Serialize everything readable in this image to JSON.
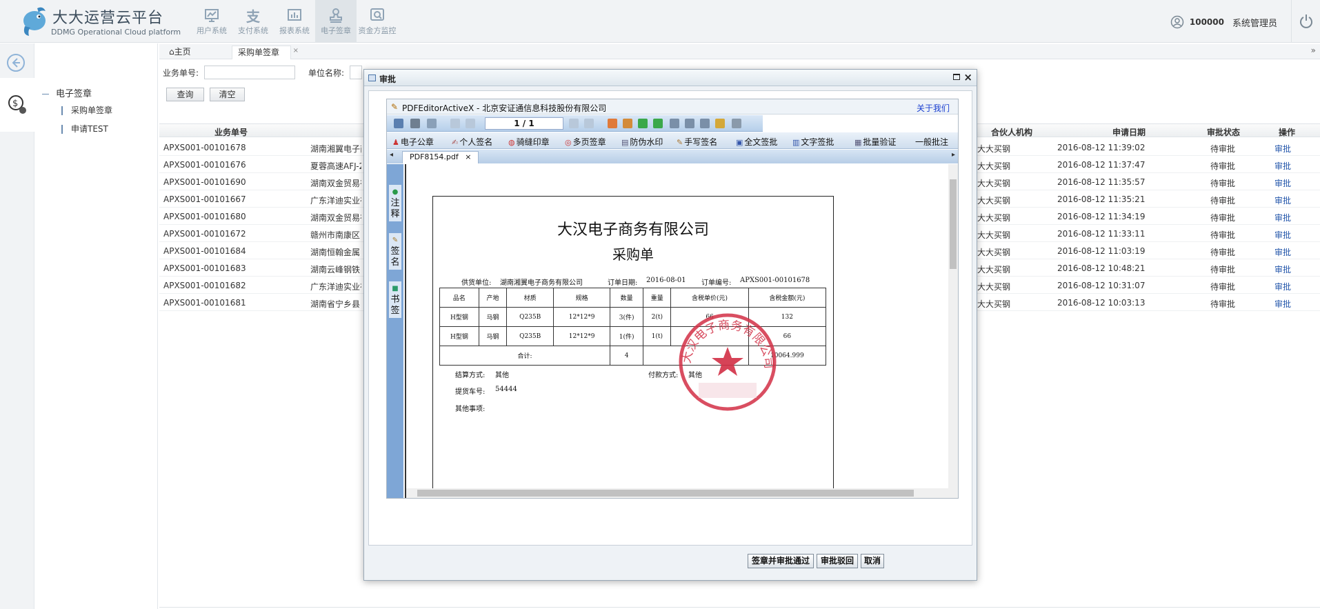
{
  "header": {
    "brand_cn": "大大运营云平台",
    "brand_en": "DDMG Operational Cloud platform",
    "nav": [
      {
        "label": "用户系统",
        "icon": "chart-board-icon"
      },
      {
        "label": "支付系统",
        "icon": "yuan-icon"
      },
      {
        "label": "报表系统",
        "icon": "report-icon"
      },
      {
        "label": "电子签章",
        "icon": "stamp-icon"
      },
      {
        "label": "资金方监控",
        "icon": "monitor-icon"
      }
    ],
    "active_nav": "电子签章",
    "user_id": "100000",
    "user_role": "系统管理员"
  },
  "menu": {
    "group": "电子签章",
    "items": [
      "采购单签章",
      "申请TEST"
    ]
  },
  "tabs": {
    "home": "主页",
    "active": "采购单签章"
  },
  "search": {
    "biz_no_label": "业务单号:",
    "unit_label": "单位名称:",
    "query_btn": "查询",
    "clear_btn": "清空"
  },
  "table": {
    "headers": {
      "biz_no": "业务单号",
      "partner": "合伙人机构",
      "date": "申请日期",
      "status": "审批状态",
      "op": "操作"
    },
    "rows": [
      {
        "biz_no": "APXS001-00101678",
        "unit": "湖南湘翼电子商",
        "partner": "大大买钢",
        "date": "2016-08-12 11:39:02",
        "status": "待审批",
        "op": "审批"
      },
      {
        "biz_no": "APXS001-00101676",
        "unit": "夏蓉高速AFJ-2",
        "partner": "大大买钢",
        "date": "2016-08-12 11:37:47",
        "status": "待审批",
        "op": "审批"
      },
      {
        "biz_no": "APXS001-00101690",
        "unit": "湖南双金贸易有",
        "partner": "大大买钢",
        "date": "2016-08-12 11:35:57",
        "status": "待审批",
        "op": "审批"
      },
      {
        "biz_no": "APXS001-00101667",
        "unit": "广东洋迪实业有",
        "partner": "大大买钢",
        "date": "2016-08-12 11:35:21",
        "status": "待审批",
        "op": "审批"
      },
      {
        "biz_no": "APXS001-00101680",
        "unit": "湖南双金贸易有",
        "partner": "大大买钢",
        "date": "2016-08-12 11:34:19",
        "status": "待审批",
        "op": "审批"
      },
      {
        "biz_no": "APXS001-00101672",
        "unit": "赣州市南康区",
        "partner": "大大买钢",
        "date": "2016-08-12 11:33:11",
        "status": "待审批",
        "op": "审批"
      },
      {
        "biz_no": "APXS001-00101684",
        "unit": "湖南恒翰金属",
        "partner": "大大买钢",
        "date": "2016-08-12 11:03:19",
        "status": "待审批",
        "op": "审批"
      },
      {
        "biz_no": "APXS001-00101683",
        "unit": "湖南云峰钢铁",
        "partner": "大大买钢",
        "date": "2016-08-12 10:48:21",
        "status": "待审批",
        "op": "审批"
      },
      {
        "biz_no": "APXS001-00101682",
        "unit": "广东洋迪实业有",
        "partner": "大大买钢",
        "date": "2016-08-12 10:31:07",
        "status": "待审批",
        "op": "审批"
      },
      {
        "biz_no": "APXS001-00101681",
        "unit": "湖南省宁乡县",
        "partner": "大大买钢",
        "date": "2016-08-12 10:03:13",
        "status": "待审批",
        "op": "审批"
      }
    ]
  },
  "dialog": {
    "title": "审批",
    "activex_title": "PDFEditorActiveX - 北京安证通信息科技股份有限公司",
    "about": "关于我们",
    "page_indicator": "1 / 1",
    "tools": [
      "电子公章",
      "个人签名",
      "骑缝印章",
      "多页签章",
      "防伪水印",
      "手写签名",
      "全文签批",
      "文字签批",
      "批量验证",
      "一般批注"
    ],
    "doc_tab": "PDF8154.pdf",
    "side_tabs": [
      "注释",
      "签名",
      "书签"
    ],
    "buttons": {
      "approve": "签章并审批通过",
      "reject": "审批驳回",
      "cancel": "取消"
    }
  },
  "pdf": {
    "company": "大汉电子商务有限公司",
    "doc_title": "采购单",
    "supplier_label": "供货单位:",
    "supplier": "湖南湘翼电子商务有限公司",
    "order_date_label": "订单日期:",
    "order_date": "2016-08-01",
    "order_no_label": "订单编号:",
    "order_no": "APXS001-00101678",
    "table_headers": [
      "品名",
      "产地",
      "材质",
      "规格",
      "数量",
      "重量",
      "含税单价(元)",
      "含税金额(元)"
    ],
    "rows": [
      [
        "H型钢",
        "马钢",
        "Q235B",
        "12*12*9",
        "3(件)",
        "2(t)",
        "66",
        "132"
      ],
      [
        "H型钢",
        "马钢",
        "Q235B",
        "12*12*9",
        "1(件)",
        "1(t)",
        "",
        "66"
      ]
    ],
    "total_label": "合计:",
    "total_qty": "4",
    "total_amount": "10064.999",
    "settlement_label": "结算方式:",
    "settlement": "其他",
    "payment_label": "付款方式:",
    "payment": "其他",
    "plate_label": "提货车号:",
    "plate": "54444",
    "other_label": "其他事项:",
    "stamp_text": "大汉电子商务有限公司"
  },
  "colors": {
    "stamp": "#d22f45",
    "link": "#2255aa",
    "accent": "#7ea6d6"
  }
}
